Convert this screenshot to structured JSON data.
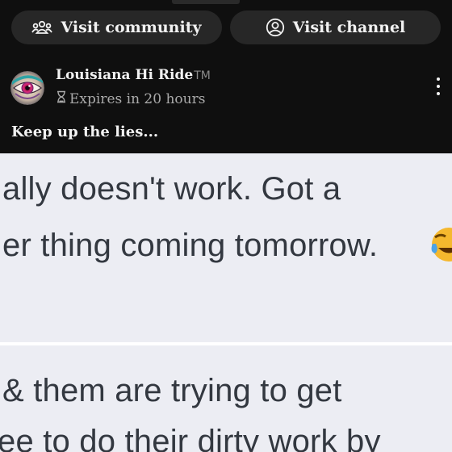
{
  "buttons": {
    "community_label": "Visit community",
    "channel_label": "Visit channel"
  },
  "post": {
    "author": "Louisiana Hi Ride",
    "trademark": "TM",
    "expires": "Expires in 20 hours",
    "caption": "Keep up the lies..."
  },
  "image": {
    "lines": [
      "ally doesn't work. Got a",
      "er thing coming tomorrow.",
      "& them are trying to get",
      "ee to do their dirty work by"
    ]
  },
  "icons": {
    "community": "community-icon",
    "channel": "account-circle-icon",
    "hourglass": "hourglass-icon",
    "more": "more-vertical-icon",
    "emoji": "laughing-crying-emoji"
  },
  "colors": {
    "background": "#0f0f0f",
    "pill": "#272727",
    "text": "#f1f1f1",
    "muted": "#aaaaaa",
    "image_bg": "#ecedf3"
  }
}
